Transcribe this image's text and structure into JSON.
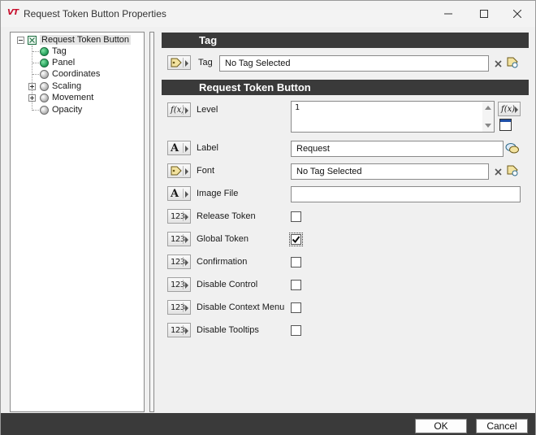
{
  "window": {
    "title": "Request Token Button Properties",
    "logo_text": "VT"
  },
  "tree": {
    "root": "Request Token Button",
    "items": [
      {
        "label": "Tag",
        "icon": "green-ball-icon"
      },
      {
        "label": "Panel",
        "icon": "green-ball-icon"
      },
      {
        "label": "Coordinates",
        "icon": "gray-ball-icon"
      },
      {
        "label": "Scaling",
        "icon": "gray-ball-icon"
      },
      {
        "label": "Movement",
        "icon": "gray-ball-icon"
      },
      {
        "label": "Opacity",
        "icon": "gray-ball-icon"
      }
    ]
  },
  "sections": {
    "tag_header": "Tag",
    "button_header": "Request Token Button"
  },
  "tag_row": {
    "label": "Tag",
    "value": "No Tag Selected"
  },
  "level": {
    "label": "Level",
    "value": "1",
    "fx_symbol": "f(x)"
  },
  "label_row": {
    "label": "Label",
    "value": "Request",
    "A_symbol": "A"
  },
  "font_row": {
    "label": "Font",
    "value": "No Tag Selected"
  },
  "image_row": {
    "label": "Image File",
    "value": "",
    "A_symbol": "A"
  },
  "num_symbol": "123",
  "checkboxes": [
    {
      "label": "Release Token",
      "checked": false
    },
    {
      "label": "Global Token",
      "checked": true
    },
    {
      "label": "Confirmation",
      "checked": false
    },
    {
      "label": "Disable Control",
      "checked": false
    },
    {
      "label": "Disable Context Menu",
      "checked": false
    },
    {
      "label": "Disable Tooltips",
      "checked": false
    }
  ],
  "buttons": {
    "ok": "OK",
    "cancel": "Cancel"
  },
  "colors": {
    "header_bg": "#3a3a3a",
    "logo_red": "#c8102e",
    "ball_green": "#1f9a55"
  }
}
